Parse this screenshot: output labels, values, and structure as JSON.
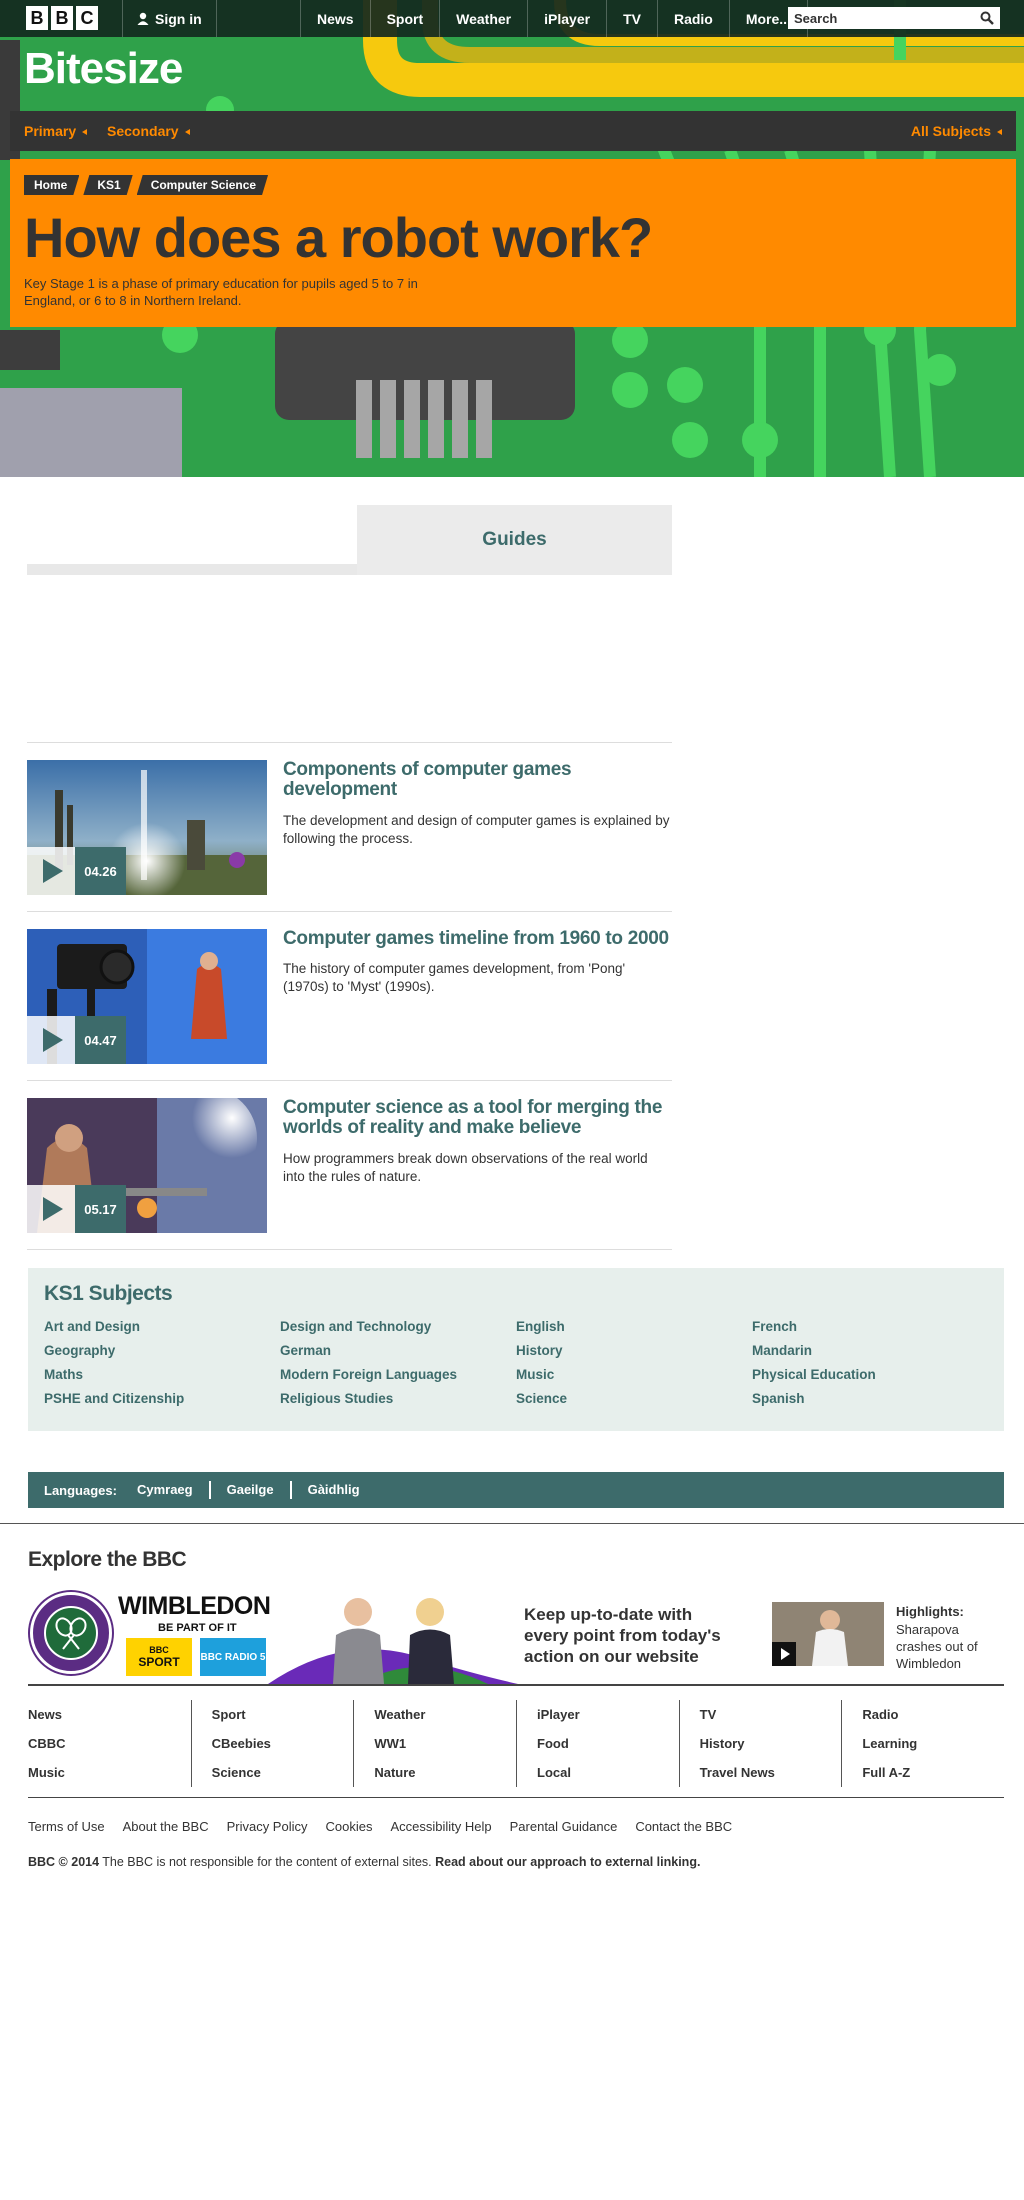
{
  "top_bar": {
    "logo_letters": [
      "B",
      "B",
      "C"
    ],
    "sign_in": "Sign in",
    "nav": [
      "News",
      "Sport",
      "Weather",
      "iPlayer",
      "TV",
      "Radio",
      "More..."
    ],
    "search_placeholder": "Search"
  },
  "hero": {
    "brand": "Bitesize",
    "subnav": {
      "primary": "Primary",
      "secondary": "Secondary",
      "all_subjects": "All Subjects"
    },
    "breadcrumb": [
      "Home",
      "KS1",
      "Computer Science"
    ],
    "title": "How does a robot work?",
    "description": "Key Stage 1 is a phase of primary education for pupils aged 5 to 7 in England, or 6 to 8 in Northern Ireland.",
    "colors": {
      "green": "#2fa14a",
      "orange": "#ff8a00",
      "dark": "#333333"
    }
  },
  "guides_tab": {
    "label": "Guides"
  },
  "guides": [
    {
      "title": "Components of computer games development",
      "description": "The development and design of computer games is explained by following the process.",
      "duration": "04.26"
    },
    {
      "title": "Computer games timeline from 1960 to 2000",
      "description": "The history of computer games development, from 'Pong' (1970s) to 'Myst' (1990s).",
      "duration": "04.47"
    },
    {
      "title": "Computer science as a tool for merging the worlds of reality and make believe",
      "description": "How programmers break down observations of the real world into the rules of nature.",
      "duration": "05.17"
    }
  ],
  "ks1_subjects": {
    "heading": "KS1 Subjects",
    "items": [
      "Art and Design",
      "Design and Technology",
      "English",
      "French",
      "Geography",
      "German",
      "History",
      "Mandarin",
      "Maths",
      "Modern Foreign Languages",
      "Music",
      "Physical Education",
      "PSHE and Citizenship",
      "Religious Studies",
      "Science",
      "Spanish"
    ]
  },
  "languages": {
    "label": "Languages:",
    "items": [
      "Cymraeg",
      "Gaeilge",
      "Gàidhlig"
    ]
  },
  "explore": {
    "heading": "Explore the BBC",
    "promo": {
      "wimbledon_title": "WIMBLEDON",
      "wimbledon_sub": "BE PART OF IT",
      "sport_badge_top": "BBC",
      "sport_badge": "SPORT",
      "radio_badge": "BBC RADIO 5",
      "headline": "Keep up-to-date with every point from today's action on our website",
      "highlight_title": "Highlights:",
      "highlight_text": "Sharapova crashes out of Wimbledon"
    },
    "links": [
      [
        "News",
        "CBBC",
        "Music"
      ],
      [
        "Sport",
        "CBeebies",
        "Science"
      ],
      [
        "Weather",
        "WW1",
        "Nature"
      ],
      [
        "iPlayer",
        "Food",
        "Local"
      ],
      [
        "TV",
        "History",
        "Travel News"
      ],
      [
        "Radio",
        "Learning",
        "Full A-Z"
      ]
    ],
    "small_links": [
      "Terms of Use",
      "About the BBC",
      "Privacy Policy",
      "Cookies",
      "Accessibility Help",
      "Parental Guidance",
      "Contact the BBC"
    ],
    "copyright_bold": "BBC © 2014",
    "copyright_text": " The BBC is not responsible for the content of external sites. ",
    "copyright_link": "Read about our approach to external linking."
  }
}
